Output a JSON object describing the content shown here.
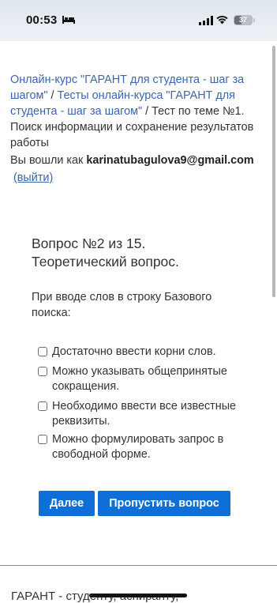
{
  "status": {
    "time": "00:53",
    "battery": "37"
  },
  "breadcrumb": {
    "link1": "Онлайн-курс \"ГАРАНТ для студента - шаг за шагом\"",
    "sep1": " / ",
    "link2": "Тесты онлайн-курса \"ГАРАНТ для студента - шаг за шагом\"",
    "sep2": " / ",
    "current": "Тест по теме №1. Поиск информации и сохранение результатов работы"
  },
  "login": {
    "prefix": "Вы вошли как ",
    "email": "karinatubagulova9@gmail.com",
    "logout": "(выйти)"
  },
  "question": {
    "title_line1": "Вопрос №2 из 15.",
    "title_line2": "Теоретический вопрос.",
    "text": "При вводе слов в строку Базового поиска:",
    "options": [
      {
        "label": "Достаточно ввести корни слов.",
        "checked": false
      },
      {
        "label": "Можно указывать общепринятые сокращения.",
        "checked": false
      },
      {
        "label": "Необходимо ввести все известные реквизиты.",
        "checked": false
      },
      {
        "label": "Можно формулировать запрос в свободной форме.",
        "checked": false
      }
    ]
  },
  "buttons": {
    "next": "Далее",
    "skip": "Пропустить вопрос"
  },
  "footer": {
    "text": "ГАРАНТ - студенту, аспиранту,"
  },
  "colors": {
    "accent": "#0f6fd9",
    "link": "#3a65b1",
    "divider": "#e06b4a"
  }
}
